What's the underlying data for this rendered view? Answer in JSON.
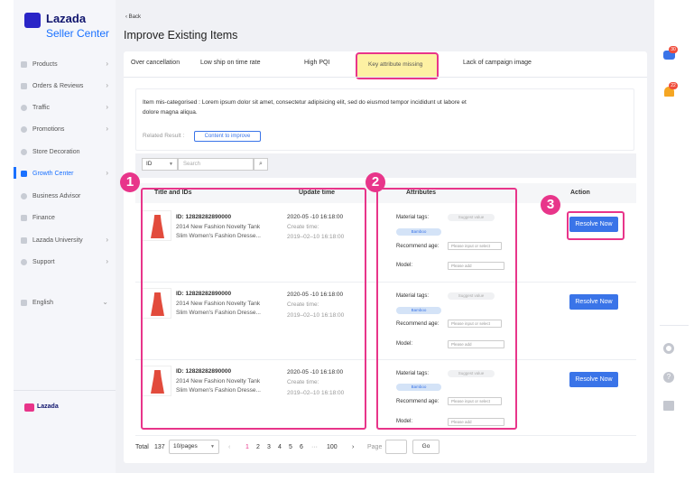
{
  "brand": {
    "name": "Lazada",
    "product": "Seller Center",
    "footer_logo_text": "Lazada"
  },
  "sidebar": {
    "items": [
      {
        "label": "Products",
        "chevron": true
      },
      {
        "label": "Orders & Reviews",
        "chevron": true
      },
      {
        "label": "Traffic",
        "chevron": true
      },
      {
        "label": "Promotions",
        "chevron": true
      },
      {
        "label": "Store Decoration",
        "chevron": false
      },
      {
        "label": "Growth Center",
        "chevron": true,
        "active": true
      },
      {
        "label": "Business Advisor",
        "chevron": false
      },
      {
        "label": "Finance",
        "chevron": false
      },
      {
        "label": "Lazada University",
        "chevron": true
      },
      {
        "label": "Support",
        "chevron": true
      }
    ],
    "language": "English"
  },
  "header": {
    "back_label": "Back",
    "title": "Improve Existing Items"
  },
  "tabs": [
    {
      "label": "Over cancellation"
    },
    {
      "label": "Low ship on time rate"
    },
    {
      "label": "High PQI"
    },
    {
      "label": "Key attribute missing",
      "active": true
    },
    {
      "label": "Lack of campaign image"
    }
  ],
  "info": {
    "text_line1": "Item mis-categorised : Lorem ipsum dolor sit amet, consectetur adipisicing elit, sed do eiusmod tempor incididunt ut labore et",
    "text_line2": "dolore magna aliqua.",
    "related_label": "Related Result :",
    "content_button": "Content to improve"
  },
  "filter": {
    "select_value": "ID",
    "search_placeholder": "Search"
  },
  "table": {
    "headers": {
      "title": "Title and IDs",
      "update": "Update time",
      "attributes": "Attributes",
      "action": "Action"
    },
    "rows": [
      {
        "id": "ID: 12828282890000",
        "name1": "2014 New Fashion Novelty Tank",
        "name2": "Slim Women's Fashion Dresse...",
        "update": "2020-05 -10  16:18:00",
        "create_label": "Create time:",
        "create": "2019–02–10  16:18:00",
        "action": "Resolve Now"
      },
      {
        "id": "ID: 12828282890000",
        "name1": "2014 New Fashion Novelty Tank",
        "name2": "Slim Women's Fashion Dresse...",
        "update": "2020-05 -10  16:18:00",
        "create_label": "Create time:",
        "create": "2019–02–10  16:18:00",
        "action": "Resolve Now"
      },
      {
        "id": "ID: 12828282890000",
        "name1": "2014 New Fashion Novelty Tank",
        "name2": "Slim Women's Fashion Dresse...",
        "update": "2020-05 -10  16:18:00",
        "create_label": "Create time:",
        "create": "2019–02–10  16:18:00",
        "action": "Resolve Now"
      }
    ],
    "attributes": {
      "material_label": "Material tags:",
      "material_placeholder": "Suggest value",
      "material_tag": "Bamboo",
      "age_label": "Recommend age:",
      "age_placeholder": "Please input or select",
      "model_label": "Model:",
      "model_placeholder": "Please add"
    }
  },
  "annotations": {
    "badge1": "1",
    "badge2": "2",
    "badge3": "3"
  },
  "pagination": {
    "total_label": "Total",
    "total": "137",
    "page_size": "10/pages",
    "pages": [
      "1",
      "2",
      "3",
      "4",
      "5",
      "6",
      "···",
      "100"
    ],
    "current": "1",
    "goto_label": "Page",
    "go_button": "Go"
  },
  "rightbar": {
    "notification_count_1": "30",
    "notification_count_2": "22"
  },
  "colors": {
    "accent": "#1a71ff",
    "highlight": "#e8358a",
    "button": "#3a74e8",
    "active_tab_bg": "#fdf1a3"
  }
}
